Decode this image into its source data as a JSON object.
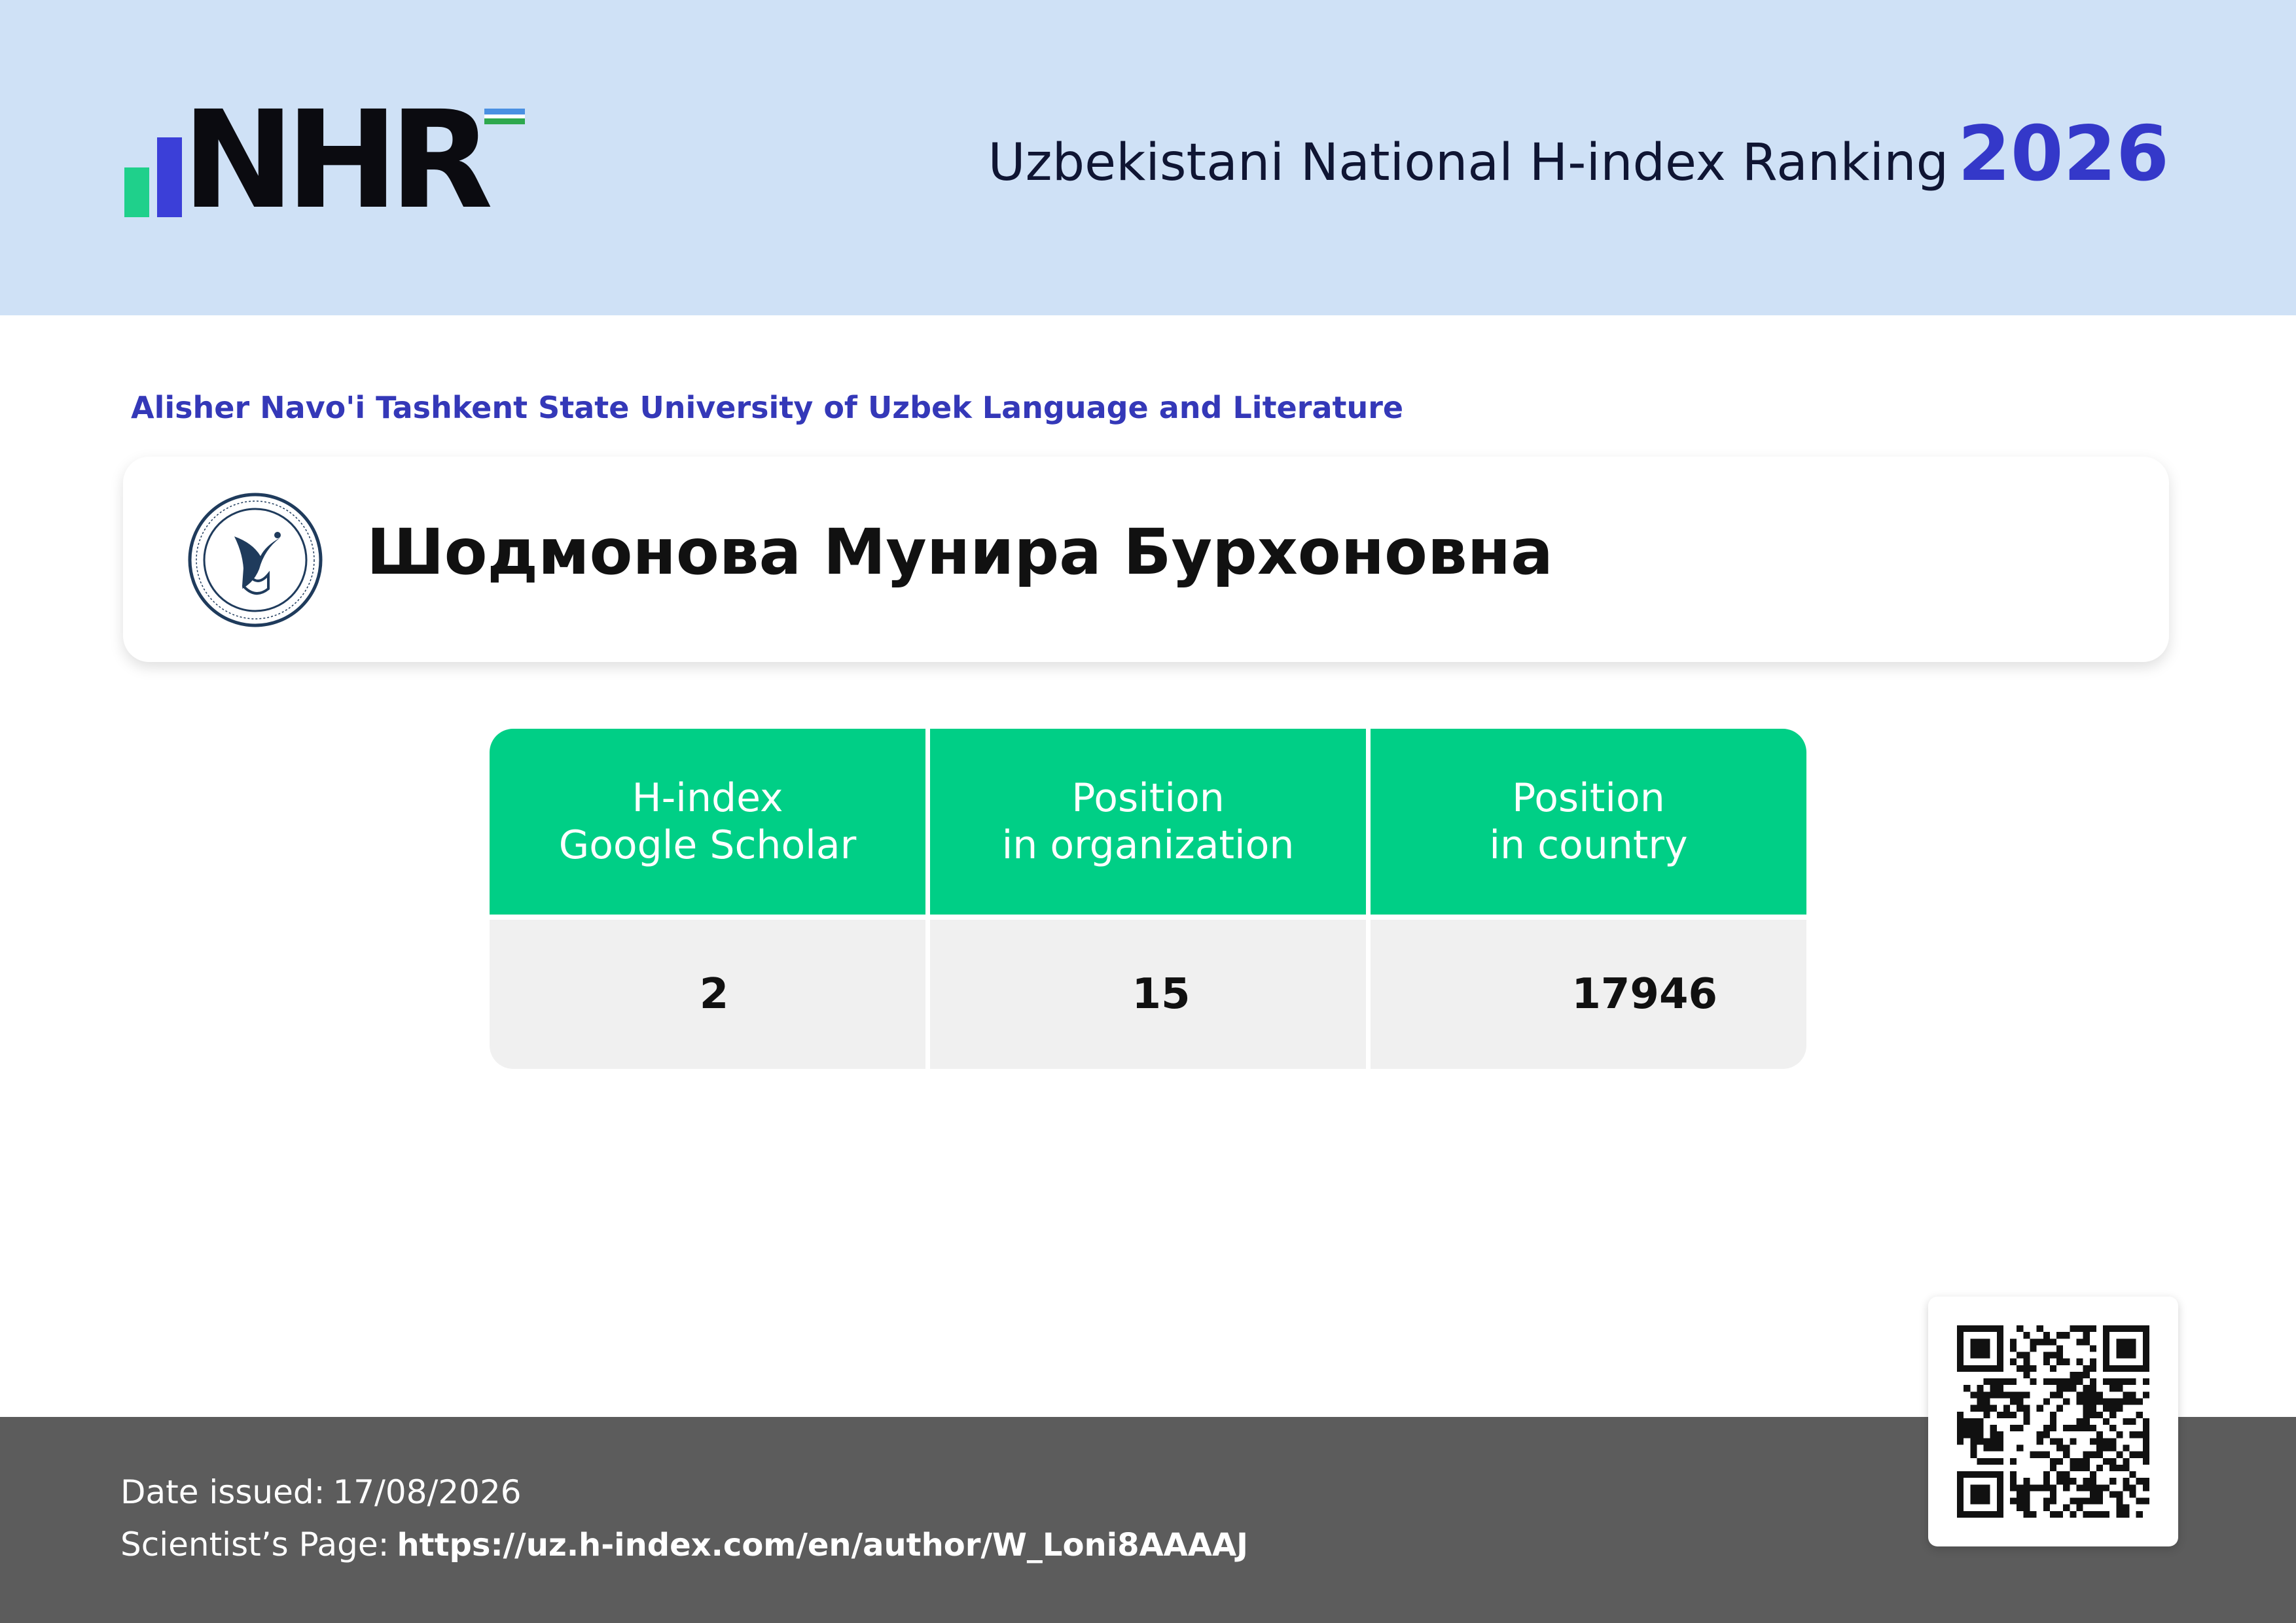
{
  "header": {
    "logo_text": "NHR",
    "title": "Uzbekistani National H-index Ranking",
    "year": "2026",
    "colors": {
      "background": "#cfe1f6",
      "accent": "#3438c9",
      "green": "#1fd08b"
    }
  },
  "organization": {
    "name": "Alisher Navo'i Tashkent State University of Uzbek Language and Literature",
    "seal_icon": "university-seal-icon"
  },
  "scientist": {
    "name": "Шодмонова Мунира Бурхоновна"
  },
  "stats": {
    "columns": [
      {
        "label_line1": "H-index",
        "label_line2": "Google Scholar",
        "value": "2"
      },
      {
        "label_line1": "Position",
        "label_line2": "in organization",
        "value": "15"
      },
      {
        "label_line1": "Position",
        "label_line2": "in country",
        "value": "17946"
      }
    ],
    "colors": {
      "header": "#00cf86",
      "value_bg": "#f0f0f0"
    }
  },
  "footer": {
    "date_label": "Date issued:",
    "date_value": "17/08/2026",
    "page_label": "Scientist’s Page:",
    "page_url": "https://uz.h-index.com/en/author/W_Loni8AAAAJ",
    "qr_icon": "qr-code-icon",
    "colors": {
      "background": "#5c5c5c"
    }
  }
}
